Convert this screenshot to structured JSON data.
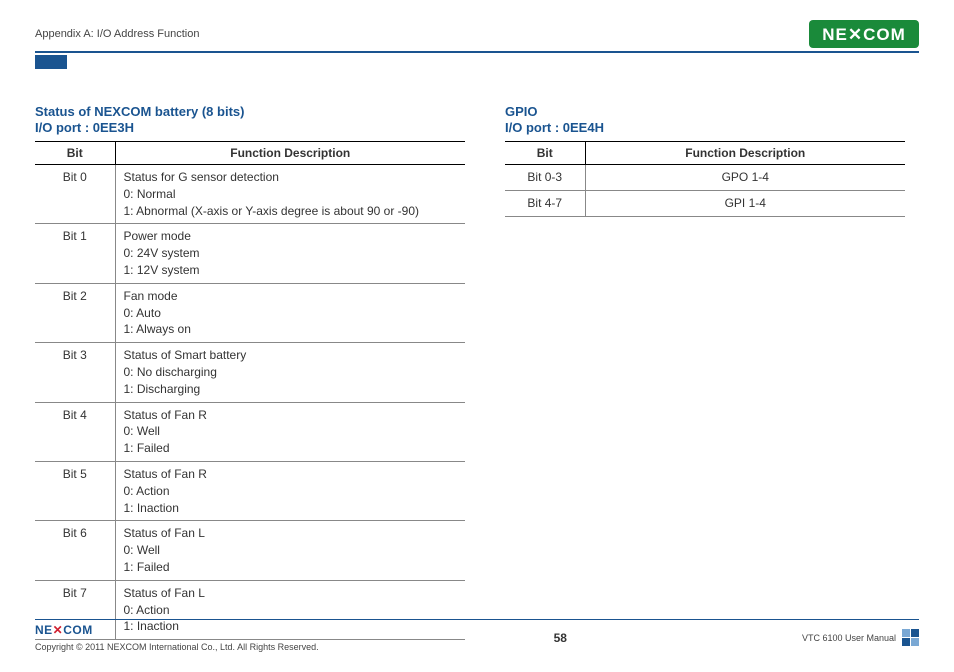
{
  "header": {
    "title": "Appendix A: I/O Address Function",
    "logo_text": "NEXCOM"
  },
  "left": {
    "title": "Status of NEXCOM battery (8 bits)",
    "subtitle": "I/O port : 0EE3H",
    "headers": {
      "bit": "Bit",
      "desc": "Function Description"
    },
    "rows": [
      {
        "bit": "Bit 0",
        "desc": "Status for G sensor detection\n0: Normal\n1: Abnormal (X-axis or Y-axis degree is about 90 or -90)"
      },
      {
        "bit": "Bit 1",
        "desc": "Power mode\n0: 24V system\n1: 12V system"
      },
      {
        "bit": "Bit 2",
        "desc": "Fan mode\n0: Auto\n1: Always on"
      },
      {
        "bit": "Bit 3",
        "desc": "Status of Smart battery\n0: No discharging\n1: Discharging"
      },
      {
        "bit": "Bit 4",
        "desc": "Status of Fan R\n0: Well\n1: Failed"
      },
      {
        "bit": "Bit 5",
        "desc": "Status of Fan R\n0: Action\n1: Inaction"
      },
      {
        "bit": "Bit 6",
        "desc": "Status of Fan L\n0: Well\n1: Failed"
      },
      {
        "bit": "Bit 7",
        "desc": "Status of Fan L\n0: Action\n1: Inaction"
      }
    ]
  },
  "right": {
    "title": "GPIO",
    "subtitle": "I/O port : 0EE4H",
    "headers": {
      "bit": "Bit",
      "desc": "Function Description"
    },
    "rows": [
      {
        "bit": "Bit 0-3",
        "desc": "GPO 1-4"
      },
      {
        "bit": "Bit 4-7",
        "desc": "GPI 1-4"
      }
    ]
  },
  "footer": {
    "logo_text": "NEXCOM",
    "copyright": "Copyright © 2011 NEXCOM International Co., Ltd. All Rights Reserved.",
    "page": "58",
    "manual": "VTC 6100 User Manual"
  }
}
